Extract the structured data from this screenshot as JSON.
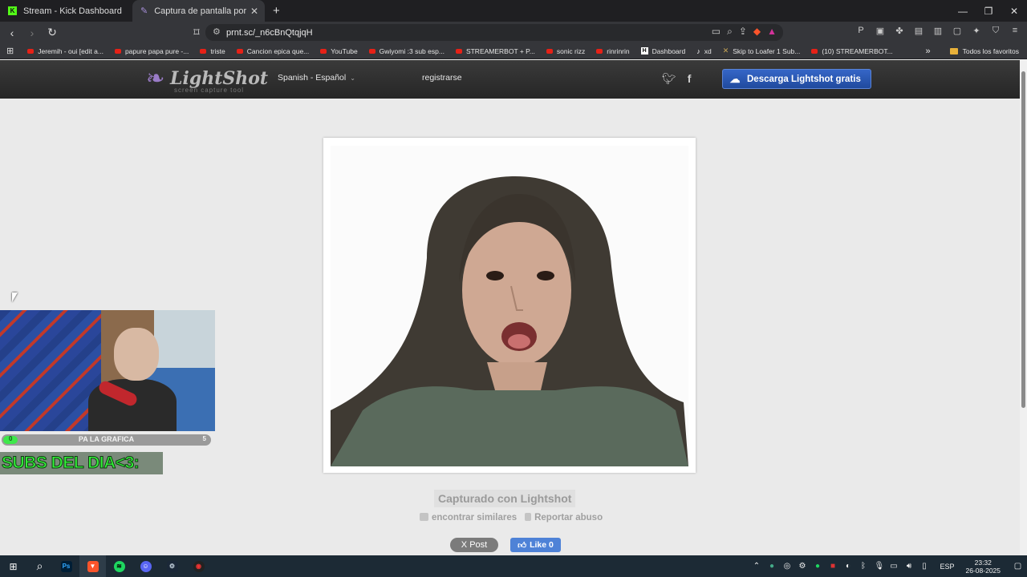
{
  "browser": {
    "tabs": [
      {
        "title": "Stream - Kick Dashboard",
        "icon": "kick-icon",
        "active": false
      },
      {
        "title": "Captura de pantalla por Lightsh",
        "icon": "feather-icon",
        "active": true
      }
    ],
    "new_tab": "+",
    "url": "prnt.sc/_n6cBnQtqjqH",
    "bookmarks": [
      {
        "label": "Jeremih - oui [edit a...",
        "icon": "youtube-icon"
      },
      {
        "label": "papure papa pure -...",
        "icon": "youtube-icon"
      },
      {
        "label": "triste",
        "icon": "youtube-icon"
      },
      {
        "label": "Cancion epica que...",
        "icon": "youtube-icon"
      },
      {
        "label": "YouTube",
        "icon": "youtube-icon"
      },
      {
        "label": "Gwiyomi :3 sub esp...",
        "icon": "youtube-icon"
      },
      {
        "label": "STREAMERBOT + P...",
        "icon": "youtube-icon"
      },
      {
        "label": "sonic rizz",
        "icon": "youtube-icon"
      },
      {
        "label": "rinrinrin",
        "icon": "youtube-icon"
      },
      {
        "label": "Dashboard",
        "icon": "h-icon"
      },
      {
        "label": "xd",
        "icon": "tiktok-icon"
      },
      {
        "label": "Skip to Loafer 1 Sub...",
        "icon": "bookmark-icon"
      },
      {
        "label": "(10) STREAMERBOT...",
        "icon": "youtube-icon"
      }
    ],
    "bookmarks_more": "»",
    "all_bookmarks": "Todos los favoritos"
  },
  "site": {
    "logo_text": "LightShot",
    "logo_tagline": "screen capture tool",
    "language": "Spanish - Español",
    "register": "registrarse",
    "download_button": "Descarga Lightshot gratis",
    "captured_with": "Capturado con Lightshot",
    "find_similar": "encontrar similares",
    "report_abuse": "Reportar abuso",
    "x_post": "X Post",
    "fb_like": "Like 0"
  },
  "stream_overlay": {
    "goal_label": "PA LA GRAFICA",
    "goal_current": "0",
    "goal_max": "5",
    "goal_progress": 0.05,
    "subs_text": "SUBS DEL DIA<3:"
  },
  "taskbar": {
    "language": "ESP",
    "time": "23:32",
    "date": "26-08-2025"
  }
}
